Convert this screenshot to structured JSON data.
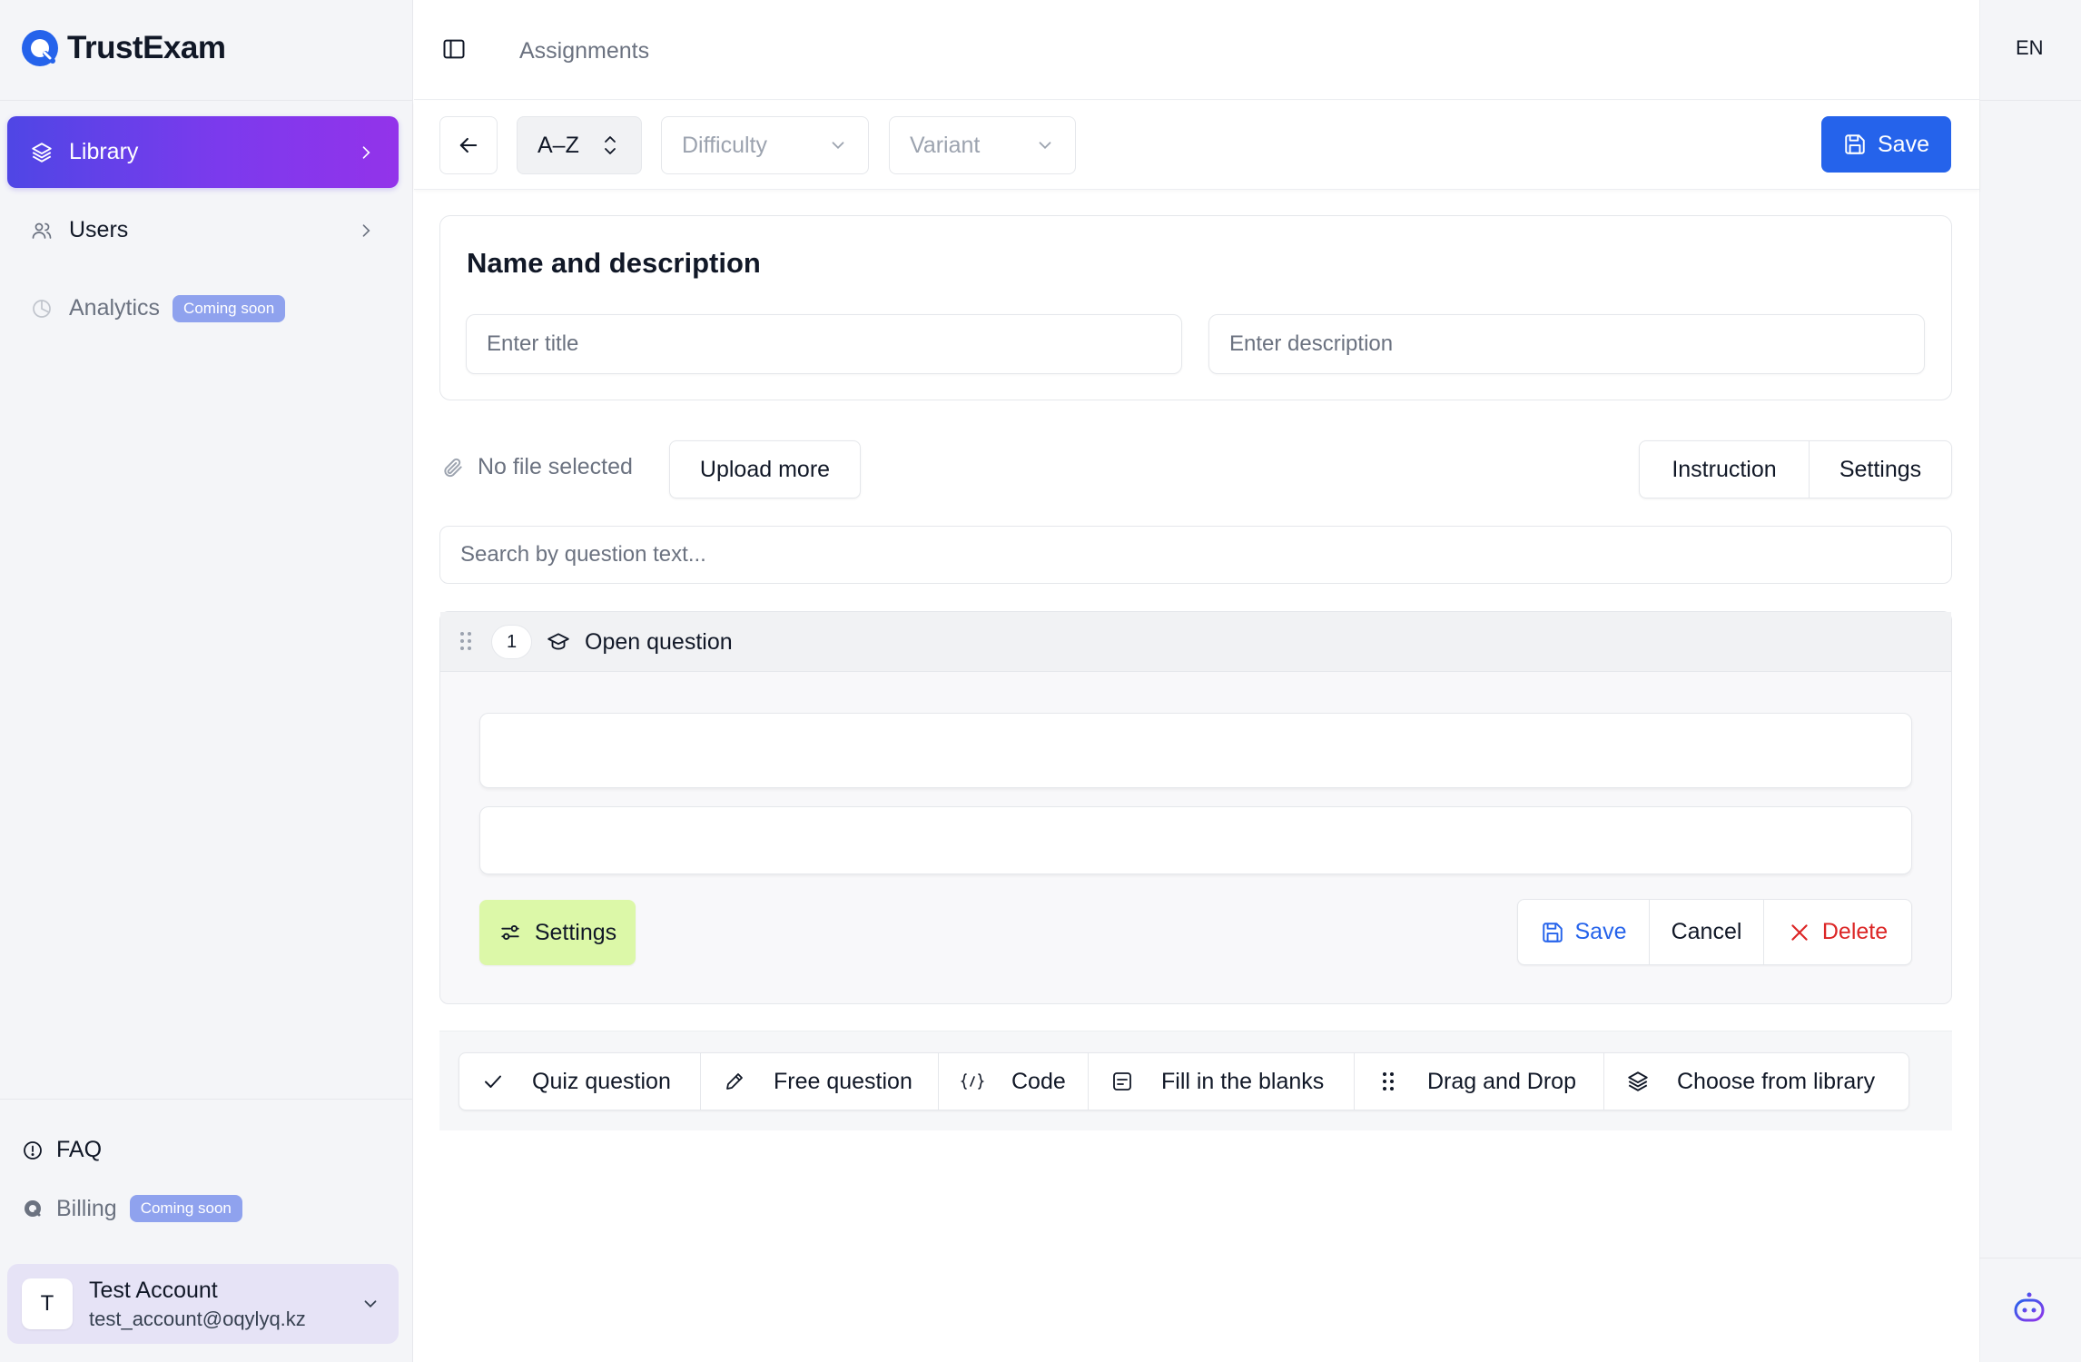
{
  "brand": {
    "name": "TrustExam",
    "accent": "#2563eb"
  },
  "sidebar": {
    "items": [
      {
        "label": "Library",
        "icon": "layers-icon",
        "active": true
      },
      {
        "label": "Users",
        "icon": "users-icon"
      },
      {
        "label": "Analytics",
        "icon": "pie-chart-icon",
        "badge": "Coming soon",
        "disabled": true
      }
    ],
    "bottom": {
      "faq": "FAQ",
      "billing": "Billing",
      "billing_badge": "Coming soon"
    },
    "account": {
      "initial": "T",
      "name": "Test Account",
      "email": "test_account@oqylyq.kz"
    }
  },
  "header": {
    "breadcrumb": "Assignments",
    "language": "EN"
  },
  "toolbar": {
    "sort": "A–Z",
    "difficulty_placeholder": "Difficulty",
    "variant_placeholder": "Variant",
    "save": "Save"
  },
  "name_section": {
    "title": "Name and description",
    "title_placeholder": "Enter title",
    "description_placeholder": "Enter description"
  },
  "files": {
    "status": "No file selected",
    "upload": "Upload more",
    "instruction": "Instruction",
    "settings": "Settings"
  },
  "search": {
    "placeholder": "Search by question text..."
  },
  "question": {
    "number": "1",
    "type": "Open question",
    "settings": "Settings",
    "save": "Save",
    "cancel": "Cancel",
    "delete": "Delete"
  },
  "add_question": [
    {
      "label": "Quiz question",
      "icon": "check-icon"
    },
    {
      "label": "Free question",
      "icon": "pencil-icon"
    },
    {
      "label": "Code",
      "icon": "code-icon"
    },
    {
      "label": "Fill in the blanks",
      "icon": "blanks-icon"
    },
    {
      "label": "Drag and Drop",
      "icon": "grip-icon"
    },
    {
      "label": "Choose from library",
      "icon": "layers-icon"
    }
  ],
  "colors": {
    "primary": "#2563eb",
    "active_gradient_start": "#4f46e5",
    "active_gradient_end": "#9333ea",
    "settings_bg": "#dcf8a8",
    "danger": "#dc2626",
    "badge": "#8fa2ee"
  }
}
